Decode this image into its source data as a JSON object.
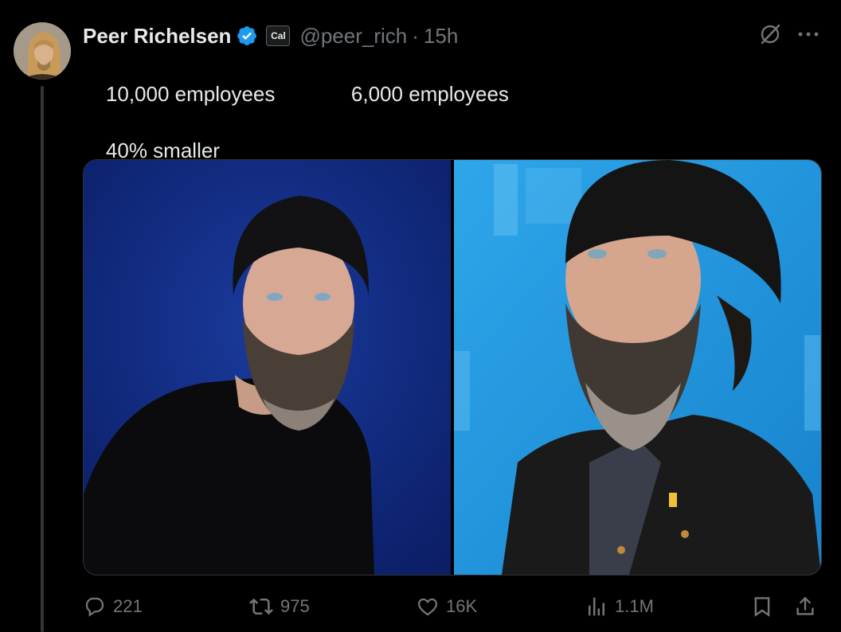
{
  "author": {
    "display_name": "Peer Richelsen",
    "handle": "@peer_rich",
    "separator": "·",
    "time": "15h",
    "affiliate_badge": "Cal",
    "verified": true
  },
  "post": {
    "line1_left": "10,000 employees",
    "line1_right": "6,000 employees",
    "line2": "40% smaller"
  },
  "media": {
    "left_photo": "portrait-man-beanie-dark-blue-background",
    "right_photo": "portrait-man-beanie-light-blue-background"
  },
  "actions": {
    "replies": "221",
    "reposts": "975",
    "likes": "16K",
    "views": "1.1M"
  },
  "colors": {
    "background": "#000000",
    "text": "#e7e9ea",
    "muted": "#71767b",
    "verified_blue": "#1d9bf0",
    "border": "#2f3336"
  }
}
